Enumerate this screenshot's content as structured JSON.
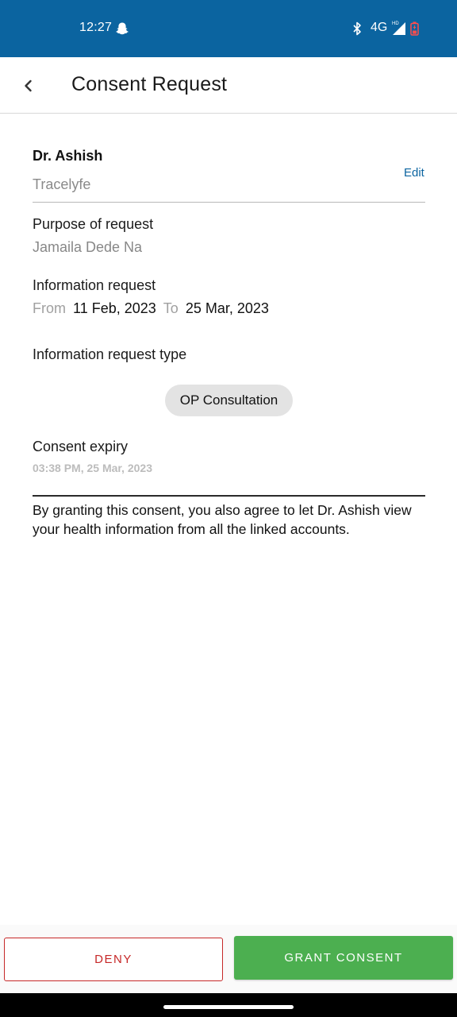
{
  "status_bar": {
    "time": "12:27",
    "network": "4G",
    "hd": "HD",
    "icons": [
      "snapchat-ghost-icon",
      "bluetooth-icon",
      "signal-icon",
      "battery-icon"
    ]
  },
  "app_bar": {
    "title": "Consent Request",
    "back_icon": "chevron-left-icon"
  },
  "requester": {
    "name": "Dr. Ashish",
    "organization": "Tracelyfe",
    "edit_label": "Edit"
  },
  "purpose": {
    "label": "Purpose of request",
    "value": "Jamaila Dede Na"
  },
  "information_request": {
    "label": "Information request",
    "from_label": "From",
    "from_date": "11 Feb, 2023",
    "to_label": "To",
    "to_date": "25 Mar, 2023"
  },
  "request_type": {
    "label": "Information request type",
    "chips": [
      "OP Consultation"
    ]
  },
  "expiry": {
    "label": "Consent expiry",
    "value": "03:38 PM, 25 Mar, 2023"
  },
  "notice": "By granting this consent, you also agree to let Dr. Ashish view your health information from all the linked accounts.",
  "actions": {
    "deny_label": "DENY",
    "grant_label": "GRANT CONSENT"
  },
  "colors": {
    "status_bar": "#0b64a0",
    "accent": "#0b64a0",
    "grant": "#4caf50",
    "deny": "#c62828"
  }
}
